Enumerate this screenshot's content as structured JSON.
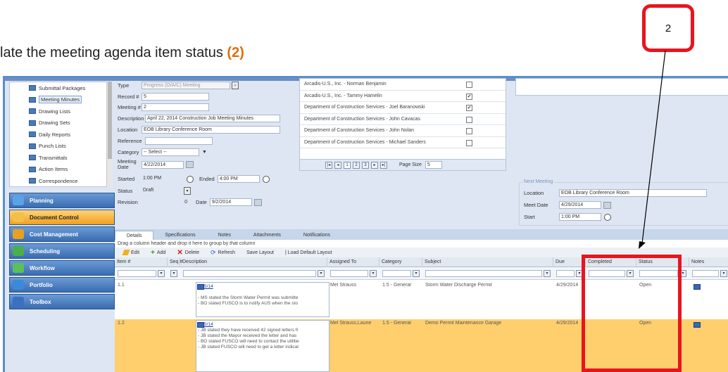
{
  "heading": {
    "text": "late the meeting agenda item status ",
    "num": "(2)"
  },
  "callout": {
    "label": "2"
  },
  "colors": {
    "accent_red": "#e8141e",
    "heading_num": "#e36c0a",
    "app_border": "#5b8ec9",
    "selected_row": "#ffcf6e"
  },
  "sidebar": {
    "items": [
      {
        "label": "Submittal Packages",
        "icon": "module-icon"
      },
      {
        "label": "Meeting Minutes",
        "icon": "module-icon",
        "selected": true
      },
      {
        "label": "Drawing Lists",
        "icon": "module-icon"
      },
      {
        "label": "Drawing Sets",
        "icon": "module-icon"
      },
      {
        "label": "Daily Reports",
        "icon": "module-icon"
      },
      {
        "label": "Punch Lists",
        "icon": "module-icon"
      },
      {
        "label": "Transmittals",
        "icon": "module-icon"
      },
      {
        "label": "Action Items",
        "icon": "module-icon"
      },
      {
        "label": "Correspondence",
        "icon": "module-icon"
      }
    ]
  },
  "nav": [
    {
      "label": "Planning"
    },
    {
      "label": "Document Control",
      "active": true
    },
    {
      "label": "Cost Management"
    },
    {
      "label": "Scheduling"
    },
    {
      "label": "Workflow"
    },
    {
      "label": "Portfolio"
    },
    {
      "label": "Toolbox"
    }
  ],
  "form": {
    "type_label": "Type",
    "type_value": "Progress (O/A/C) Meeting",
    "record_label": "Record #",
    "record_value": "5",
    "meeting_label": "Meeting #",
    "meeting_value": "2",
    "description_label": "Description",
    "description_value": "April 22, 2014 Construction Job Meeting Minutes",
    "location_label": "Location",
    "location_value": "EOB Library Conference Room",
    "reference_label": "Reference",
    "reference_value": "",
    "category_label": "Category",
    "category_value": "-- Select --",
    "meeting_date_label": "Meeting Date",
    "meeting_date_value": "4/22/2014",
    "started_label": "Started",
    "started_value": "1:00 PM",
    "ended_label": "Ended",
    "ended_value": "4:00 PM",
    "status_label": "Status",
    "status_value": "Draft",
    "revision_label": "Revision",
    "revision_value": "0",
    "date_label": "Date",
    "date_value": "9/2/2014"
  },
  "attendees": [
    {
      "name": "Arcadis-U.S., Inc. - Norman Benjamin",
      "checked": false
    },
    {
      "name": "Arcadis-U.S., Inc. - Tammy Hamelin",
      "checked": true
    },
    {
      "name": "Department of Construction Services - Joel Baranowski",
      "checked": true
    },
    {
      "name": "Department of Construction Services - John Cavacas",
      "checked": false
    },
    {
      "name": "Department of Construction Services - John Nolan",
      "checked": false
    },
    {
      "name": "Department of Construction Services - Michael Sanders",
      "checked": false
    }
  ],
  "pager": {
    "pages": [
      "1",
      "2",
      "3"
    ],
    "page_size_label": "Page Size",
    "page_size_value": "5"
  },
  "next_meeting": {
    "legend": "Next Meeting",
    "location_label": "Location",
    "location_value": "EOB Library Conference Room",
    "meet_date_label": "Meet Date",
    "meet_date_value": "4/29/2014",
    "start_label": "Start",
    "start_value": "1:00 PM"
  },
  "tabs": [
    "Details",
    "Specifications",
    "Notes",
    "Attachments",
    "Notifications"
  ],
  "group_hint": "Drag a column header and drop it here to group by that column",
  "toolbar": {
    "edit": "Edit",
    "add": "Add",
    "delete": "Delete",
    "refresh": "Refresh",
    "save_layout": "Save Layout",
    "load_default": "| Load Default Layout"
  },
  "columns": [
    "Item #",
    "Seq #",
    "Description",
    "Assigned To",
    "Category",
    "Subject",
    "Due",
    "Completed",
    "Status",
    "Notes"
  ],
  "rows": [
    {
      "item": "1.1",
      "date": "3/25/14",
      "lines": [
        "- MS stated the Storm Water Permit was submitte",
        "- BO stated FUSCO is to notify AUS when the sto"
      ],
      "assigned": "Mel Strauss",
      "category": "1.5 - General",
      "subject": "Storm Water Discharge Permit",
      "due": "4/29/2014",
      "completed": "",
      "status": "Open"
    },
    {
      "item": "1.2",
      "date": "3/25/14",
      "lines": [
        "- JB stated they have received 42 signed letters fr",
        "- JB stated the Mayor received the letter and has",
        "- BO stated FUSCO will need to contact the utilitie",
        "- JB stated FUSCO will need to get a letter indicat"
      ],
      "assigned": "Mel Strauss,Laurie",
      "category": "1.5 - General",
      "subject": "Demo Permit Maintenance Garage",
      "due": "4/29/2014",
      "completed": "",
      "status": "Open"
    }
  ]
}
